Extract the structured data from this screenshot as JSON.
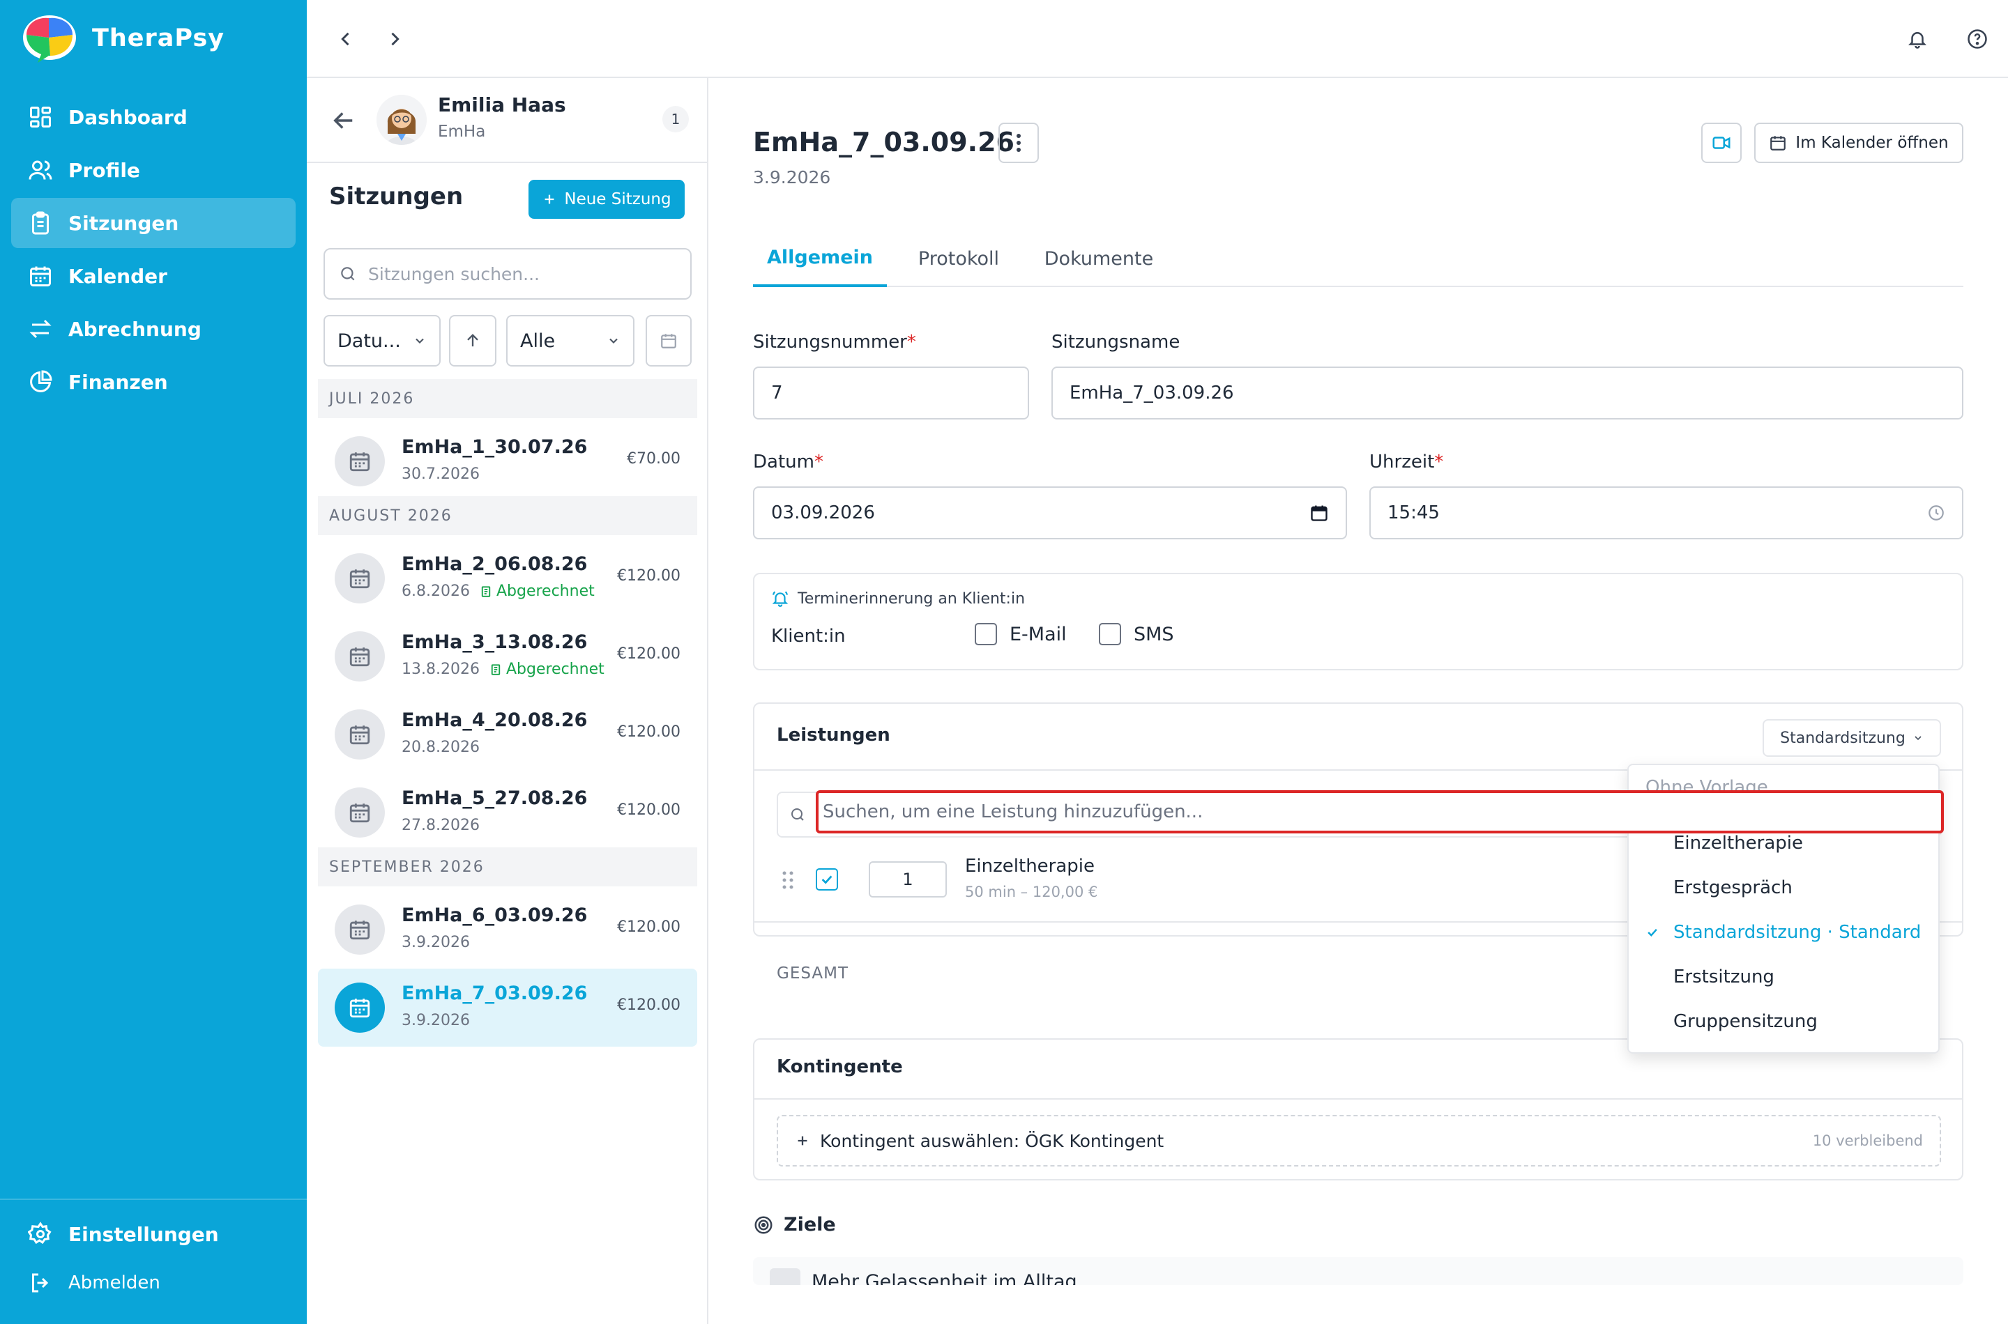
{
  "app": {
    "name": "TheraPsy"
  },
  "sidebar": {
    "items": [
      {
        "label": "Dashboard",
        "icon": "dashboard-icon"
      },
      {
        "label": "Profile",
        "icon": "users-icon"
      },
      {
        "label": "Sitzungen",
        "icon": "clipboard-icon",
        "active": true
      },
      {
        "label": "Kalender",
        "icon": "calendar-icon"
      },
      {
        "label": "Abrechnung",
        "icon": "arrows-exchange-icon"
      },
      {
        "label": "Finanzen",
        "icon": "pie-chart-icon"
      }
    ],
    "settings_label": "Einstellungen",
    "logout_label": "Abmelden"
  },
  "client": {
    "name": "Emilia Haas",
    "short": "EmHa",
    "count": "1"
  },
  "list": {
    "title": "Sitzungen",
    "new_button": "Neue Sitzung",
    "search_placeholder": "Sitzungen suchen...",
    "sort_label": "Datu...",
    "filter_label": "Alle",
    "sections": [
      "JULI 2026",
      "AUGUST 2026",
      "SEPTEMBER 2026"
    ],
    "sessions": [
      {
        "name": "EmHa_1_30.07.26",
        "date": "30.7.2026",
        "price": "€70.00",
        "badge": ""
      },
      {
        "name": "EmHa_2_06.08.26",
        "date": "6.8.2026",
        "price": "€120.00",
        "badge": "Abgerechnet"
      },
      {
        "name": "EmHa_3_13.08.26",
        "date": "13.8.2026",
        "price": "€120.00",
        "badge": "Abgerechnet"
      },
      {
        "name": "EmHa_4_20.08.26",
        "date": "20.8.2026",
        "price": "€120.00",
        "badge": ""
      },
      {
        "name": "EmHa_5_27.08.26",
        "date": "27.8.2026",
        "price": "€120.00",
        "badge": ""
      },
      {
        "name": "EmHa_6_03.09.26",
        "date": "3.9.2026",
        "price": "€120.00",
        "badge": ""
      },
      {
        "name": "EmHa_7_03.09.26",
        "date": "3.9.2026",
        "price": "€120.00",
        "badge": ""
      }
    ]
  },
  "detail": {
    "title": "EmHa_7_03.09.26",
    "date": "3.9.2026",
    "calendar_button": "Im Kalender öffnen",
    "tabs": [
      "Allgemein",
      "Protokoll",
      "Dokumente"
    ],
    "fields": {
      "number_label": "Sitzungsnummer",
      "number_value": "7",
      "name_label": "Sitzungsname",
      "name_value": "EmHa_7_03.09.26",
      "date_label": "Datum",
      "date_value": "03.09.2026",
      "time_label": "Uhrzeit",
      "time_value": "15:45"
    },
    "reminder": {
      "title": "Terminerinnerung an Klient:in",
      "row_label": "Klient:in",
      "email_label": "E-Mail",
      "sms_label": "SMS"
    },
    "services": {
      "title": "Leistungen",
      "template_select": "Standardsitzung",
      "search_placeholder": "Suchen, um eine Leistung hinzuzufügen...",
      "item": {
        "qty": "1",
        "name": "Einzeltherapie",
        "meta": "50 min – 120,00 €"
      },
      "total_label": "GESAMT"
    },
    "template_dropdown": {
      "options": [
        "Ohne Vorlage",
        "Einzeltherapie",
        "Erstgespräch",
        "Standardsitzung · Standard",
        "Erstsitzung",
        "Gruppensitzung"
      ],
      "selected": "Standardsitzung · Standard"
    },
    "quota": {
      "title": "Kontingente",
      "select_label": "Kontingent auswählen: ÖGK Kontingent",
      "remaining": "10 verbleibend"
    },
    "goals": {
      "title": "Ziele",
      "first_item": "Mehr Gelassenheit im Alltag"
    }
  },
  "colors": {
    "brand": "#0aa5d8",
    "success": "#16a34a",
    "required": "#dc2626",
    "highlight": "#dc2626"
  }
}
